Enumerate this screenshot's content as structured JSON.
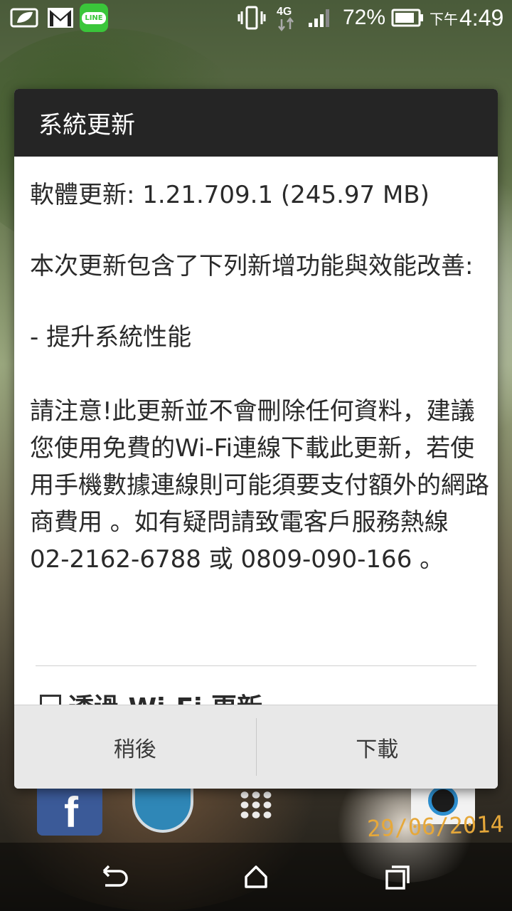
{
  "status_bar": {
    "icons": [
      "notification-leaf-icon",
      "gmail-icon",
      "line-app-icon",
      "vibrate-icon",
      "network-4g-icon",
      "signal-icon",
      "battery-icon"
    ],
    "line_label": "LINE",
    "network": "4G",
    "battery": "72%",
    "ampm": "下午",
    "time": "4:49"
  },
  "dialog": {
    "title": "系統更新",
    "version_line": "軟體更新: 1.21.709.1 (245.97 MB)",
    "intro_line": "本次更新包含了下列新增功能與效能改善:",
    "item_line": "- 提升系統性能",
    "note_line": "請注意!此更新並不會刪除任何資料，建議您使用免費的Wi-Fi連線下載此更新，若使用手機數據連線則可能須要支付額外的網路商費用 。如有疑問請致電客戶服務熱線 02-2162-6788 或 0809-090-166 。",
    "wifi_option_label": "透過 Wi-Fi 更新",
    "later_button": "稍後",
    "download_button": "下載"
  },
  "home_screen": {
    "date_stamp": "29/06/2014"
  },
  "navigation": {
    "icons": [
      "back-icon",
      "home-icon",
      "recent-apps-icon"
    ]
  }
}
